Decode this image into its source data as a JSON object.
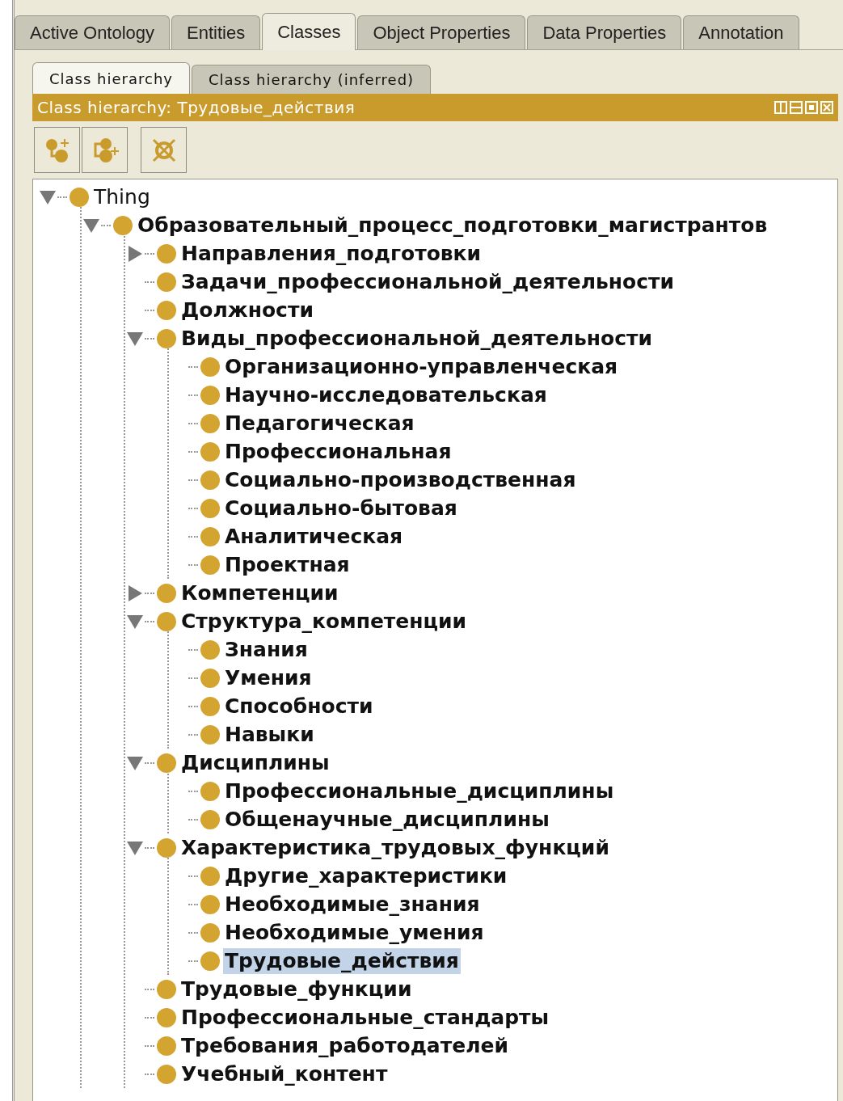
{
  "main_tabs": [
    {
      "label": "Active Ontology",
      "selected": false
    },
    {
      "label": "Entities",
      "selected": false
    },
    {
      "label": "Classes",
      "selected": true
    },
    {
      "label": "Object Properties",
      "selected": false
    },
    {
      "label": "Data Properties",
      "selected": false
    },
    {
      "label": "Annotation",
      "selected": false
    }
  ],
  "sub_tabs": [
    {
      "label": "Class hierarchy",
      "selected": true
    },
    {
      "label": "Class hierarchy (inferred)",
      "selected": false
    }
  ],
  "view": {
    "title": "Class hierarchy: Трудовые_действия"
  },
  "tree": [
    {
      "label": "Thing",
      "selected": false,
      "expanded": true,
      "children": [
        {
          "label": "Образовательный_процесс_подготовки_магистрантов",
          "selected": false,
          "expanded": true,
          "children": [
            {
              "label": "Направления_подготовки",
              "selected": false,
              "expanded": false
            },
            {
              "label": "Задачи_профессиональной_деятельности",
              "selected": false
            },
            {
              "label": "Должности",
              "selected": false
            },
            {
              "label": "Виды_профессиональной_деятельности",
              "selected": false,
              "expanded": true,
              "children": [
                {
                  "label": "Организационно-управленческая",
                  "selected": false
                },
                {
                  "label": "Научно-исследовательская",
                  "selected": false
                },
                {
                  "label": "Педагогическая",
                  "selected": false
                },
                {
                  "label": "Профессиональная",
                  "selected": false
                },
                {
                  "label": "Социально-производственная",
                  "selected": false
                },
                {
                  "label": "Социально-бытовая",
                  "selected": false
                },
                {
                  "label": "Аналитическая",
                  "selected": false
                },
                {
                  "label": "Проектная",
                  "selected": false
                }
              ]
            },
            {
              "label": "Компетенции",
              "selected": false,
              "expanded": false
            },
            {
              "label": "Структура_компетенции",
              "selected": false,
              "expanded": true,
              "children": [
                {
                  "label": "Знания",
                  "selected": false
                },
                {
                  "label": "Умения",
                  "selected": false
                },
                {
                  "label": "Способности",
                  "selected": false
                },
                {
                  "label": "Навыки",
                  "selected": false
                }
              ]
            },
            {
              "label": "Дисциплины",
              "selected": false,
              "expanded": true,
              "children": [
                {
                  "label": "Профессиональные_дисциплины",
                  "selected": false
                },
                {
                  "label": "Общенаучные_дисциплины",
                  "selected": false
                }
              ]
            },
            {
              "label": "Характеристика_трудовых_функций",
              "selected": false,
              "expanded": true,
              "children": [
                {
                  "label": "Другие_характеристики",
                  "selected": false
                },
                {
                  "label": "Необходимые_знания",
                  "selected": false
                },
                {
                  "label": "Необходимые_умения",
                  "selected": false
                },
                {
                  "label": "Трудовые_действия",
                  "selected": true
                }
              ]
            },
            {
              "label": "Трудовые_функции",
              "selected": false
            },
            {
              "label": "Профессиональные_стандарты",
              "selected": false
            },
            {
              "label": "Требования_работодателей",
              "selected": false
            },
            {
              "label": "Учебный_контент",
              "selected": false
            }
          ]
        }
      ]
    }
  ]
}
